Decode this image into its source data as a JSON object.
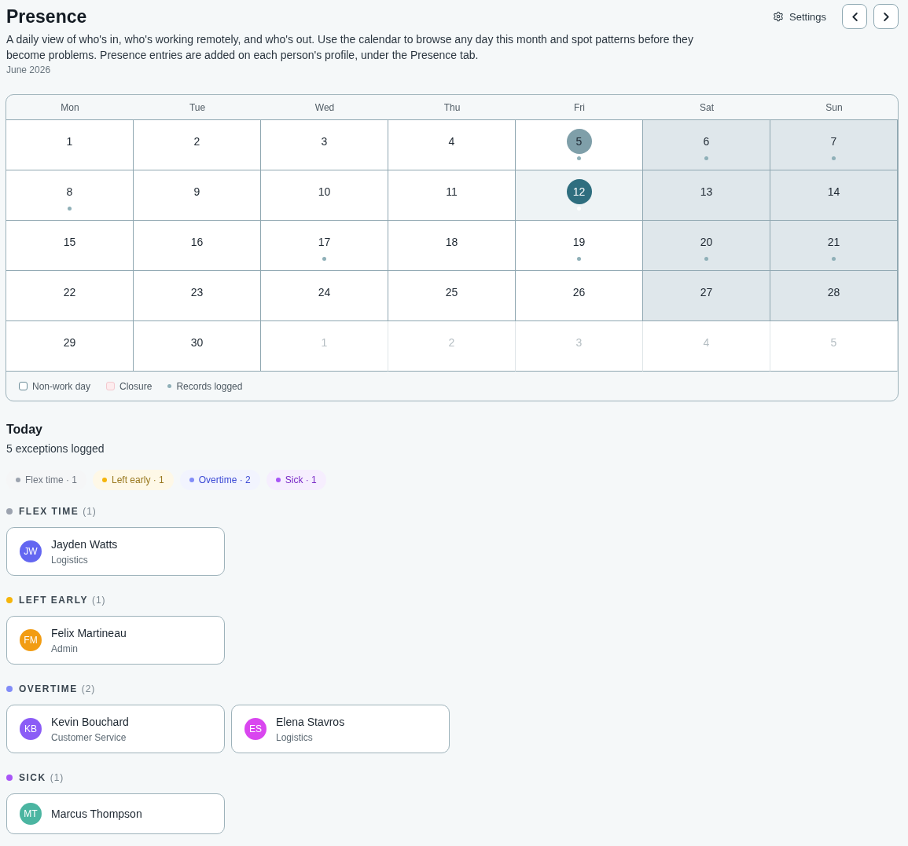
{
  "header": {
    "title": "Presence",
    "settings_label": "Settings",
    "description": "A daily view of who's in, who's working remotely, and who's out. Use the calendar to browse any day this month and spot patterns before they become problems. Presence entries are added on each person's profile, under the Presence tab.",
    "month": "June 2026"
  },
  "calendar": {
    "weekdays": [
      "Mon",
      "Tue",
      "Wed",
      "Thu",
      "Fri",
      "Sat",
      "Sun"
    ],
    "days": [
      {
        "label": "1",
        "in_month": true,
        "non_work": false,
        "records": false,
        "selected": false,
        "hovered": false
      },
      {
        "label": "2",
        "in_month": true,
        "non_work": false,
        "records": false,
        "selected": false,
        "hovered": false
      },
      {
        "label": "3",
        "in_month": true,
        "non_work": false,
        "records": false,
        "selected": false,
        "hovered": false
      },
      {
        "label": "4",
        "in_month": true,
        "non_work": false,
        "records": false,
        "selected": false,
        "hovered": false
      },
      {
        "label": "5",
        "in_month": true,
        "non_work": false,
        "records": true,
        "selected": false,
        "hovered": true
      },
      {
        "label": "6",
        "in_month": true,
        "non_work": true,
        "records": true,
        "selected": false,
        "hovered": false
      },
      {
        "label": "7",
        "in_month": true,
        "non_work": true,
        "records": true,
        "selected": false,
        "hovered": false
      },
      {
        "label": "8",
        "in_month": true,
        "non_work": false,
        "records": true,
        "selected": false,
        "hovered": false
      },
      {
        "label": "9",
        "in_month": true,
        "non_work": false,
        "records": false,
        "selected": false,
        "hovered": false
      },
      {
        "label": "10",
        "in_month": true,
        "non_work": false,
        "records": false,
        "selected": false,
        "hovered": false
      },
      {
        "label": "11",
        "in_month": true,
        "non_work": false,
        "records": false,
        "selected": false,
        "hovered": false
      },
      {
        "label": "12",
        "in_month": true,
        "non_work": false,
        "records": true,
        "selected": true,
        "hovered": false
      },
      {
        "label": "13",
        "in_month": true,
        "non_work": true,
        "records": false,
        "selected": false,
        "hovered": false
      },
      {
        "label": "14",
        "in_month": true,
        "non_work": true,
        "records": false,
        "selected": false,
        "hovered": false
      },
      {
        "label": "15",
        "in_month": true,
        "non_work": false,
        "records": false,
        "selected": false,
        "hovered": false
      },
      {
        "label": "16",
        "in_month": true,
        "non_work": false,
        "records": false,
        "selected": false,
        "hovered": false
      },
      {
        "label": "17",
        "in_month": true,
        "non_work": false,
        "records": true,
        "selected": false,
        "hovered": false
      },
      {
        "label": "18",
        "in_month": true,
        "non_work": false,
        "records": false,
        "selected": false,
        "hovered": false
      },
      {
        "label": "19",
        "in_month": true,
        "non_work": false,
        "records": true,
        "selected": false,
        "hovered": false
      },
      {
        "label": "20",
        "in_month": true,
        "non_work": true,
        "records": true,
        "selected": false,
        "hovered": false
      },
      {
        "label": "21",
        "in_month": true,
        "non_work": true,
        "records": true,
        "selected": false,
        "hovered": false
      },
      {
        "label": "22",
        "in_month": true,
        "non_work": false,
        "records": false,
        "selected": false,
        "hovered": false
      },
      {
        "label": "23",
        "in_month": true,
        "non_work": false,
        "records": false,
        "selected": false,
        "hovered": false
      },
      {
        "label": "24",
        "in_month": true,
        "non_work": false,
        "records": false,
        "selected": false,
        "hovered": false
      },
      {
        "label": "25",
        "in_month": true,
        "non_work": false,
        "records": false,
        "selected": false,
        "hovered": false
      },
      {
        "label": "26",
        "in_month": true,
        "non_work": false,
        "records": false,
        "selected": false,
        "hovered": false
      },
      {
        "label": "27",
        "in_month": true,
        "non_work": true,
        "records": false,
        "selected": false,
        "hovered": false
      },
      {
        "label": "28",
        "in_month": true,
        "non_work": true,
        "records": false,
        "selected": false,
        "hovered": false
      },
      {
        "label": "29",
        "in_month": true,
        "non_work": false,
        "records": false,
        "selected": false,
        "hovered": false
      },
      {
        "label": "30",
        "in_month": true,
        "non_work": false,
        "records": false,
        "selected": false,
        "hovered": false
      },
      {
        "label": "1",
        "in_month": false,
        "non_work": false,
        "records": false,
        "selected": false,
        "hovered": false
      },
      {
        "label": "2",
        "in_month": false,
        "non_work": false,
        "records": false,
        "selected": false,
        "hovered": false
      },
      {
        "label": "3",
        "in_month": false,
        "non_work": false,
        "records": false,
        "selected": false,
        "hovered": false
      },
      {
        "label": "4",
        "in_month": false,
        "non_work": false,
        "records": false,
        "selected": false,
        "hovered": false
      },
      {
        "label": "5",
        "in_month": false,
        "non_work": false,
        "records": false,
        "selected": false,
        "hovered": false
      }
    ],
    "legend": [
      {
        "kind": "non_work",
        "label": "Non-work day"
      },
      {
        "kind": "closure",
        "label": "Closure"
      },
      {
        "kind": "records",
        "label": "Records logged"
      }
    ]
  },
  "today": {
    "title": "Today",
    "summary": "5 exceptions logged",
    "chips": [
      {
        "label": "Flex time · 1",
        "color": "#9ca3af"
      },
      {
        "label": "Left early · 1",
        "color": "#f5b50b"
      },
      {
        "label": "Overtime · 2",
        "color": "#818cf8"
      },
      {
        "label": "Sick · 1",
        "color": "#a855f7"
      }
    ],
    "groups": [
      {
        "title": "FLEX TIME",
        "count": "(1)",
        "color": "#9ca3af",
        "people": [
          {
            "initials": "JW",
            "name": "Jayden Watts",
            "department": "Logistics",
            "color": "#6366f1"
          }
        ]
      },
      {
        "title": "LEFT EARLY",
        "count": "(1)",
        "color": "#f5b50b",
        "people": [
          {
            "initials": "FM",
            "name": "Felix Martineau",
            "department": "Admin",
            "color": "#f29c12"
          }
        ]
      },
      {
        "title": "OVERTIME",
        "count": "(2)",
        "color": "#818cf8",
        "people": [
          {
            "initials": "KB",
            "name": "Kevin Bouchard",
            "department": "Customer Service",
            "color": "#8b5cf6"
          },
          {
            "initials": "ES",
            "name": "Elena Stavros",
            "department": "Logistics",
            "color": "#d946ef"
          }
        ]
      },
      {
        "title": "SICK",
        "count": "(1)",
        "color": "#a855f7",
        "people": [
          {
            "initials": "MT",
            "name": "Marcus Thompson",
            "color": "#4bb5a1"
          }
        ]
      }
    ]
  }
}
